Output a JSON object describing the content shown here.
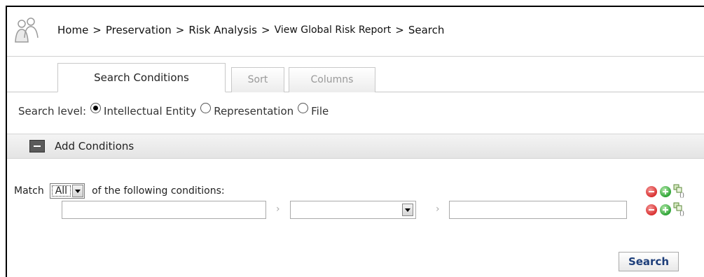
{
  "breadcrumb": {
    "items": [
      "Home",
      "Preservation",
      "Risk Analysis",
      "View Global Risk Report",
      "Search"
    ],
    "separator": ">"
  },
  "tabs": [
    {
      "label": "Search Conditions",
      "active": true
    },
    {
      "label": "Sort",
      "active": false
    },
    {
      "label": "Columns",
      "active": false
    }
  ],
  "search_level": {
    "label": "Search level:",
    "options": [
      {
        "label": "Intellectual Entity",
        "checked": true
      },
      {
        "label": "Representation",
        "checked": false
      },
      {
        "label": "File",
        "checked": false
      }
    ]
  },
  "conditions_panel": {
    "label": "Add Conditions"
  },
  "match": {
    "prefix": "Match",
    "selected": "All",
    "suffix": "of the following conditions:"
  },
  "condition_row": {
    "field_value": "",
    "operator_value": "",
    "value": "",
    "chevron": "›"
  },
  "actions": {
    "search_label": "Search"
  },
  "icons": {
    "logo": "users-icon",
    "remove": "remove-icon",
    "add": "add-icon",
    "group": "group-conditions-icon"
  },
  "colors": {
    "search_text": "#1d3e7a",
    "remove": "#d93030",
    "add": "#2ea436"
  }
}
